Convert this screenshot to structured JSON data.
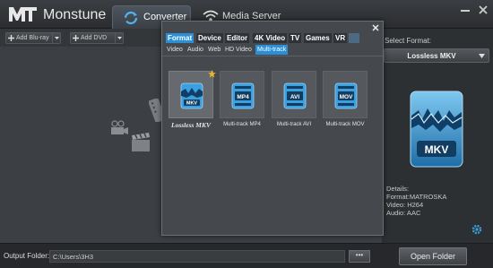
{
  "app": {
    "name": "Monstune",
    "tabs": [
      {
        "label": "Converter",
        "icon": "refresh-icon",
        "active": true
      },
      {
        "label": "Media Server",
        "icon": "wifi-icon",
        "active": false
      }
    ]
  },
  "toolbar": {
    "add_bluray": "Add Blu-ray",
    "add_dvd": "Add DVD"
  },
  "format_dialog": {
    "categories": [
      "Format",
      "Device",
      "Editor",
      "4K Video",
      "TV",
      "Games",
      "VR"
    ],
    "active_category": "Format",
    "subtabs": [
      "Video",
      "Audio",
      "Web",
      "HD Video",
      "Multi-track"
    ],
    "active_subtab": "Multi-track",
    "formats": [
      {
        "name": "Lossless MKV",
        "badge": "MKV",
        "selected": true,
        "favorite": true
      },
      {
        "name": "Multi-track MP4",
        "badge": "MP4",
        "selected": false
      },
      {
        "name": "Multi-track AVI",
        "badge": "AVI",
        "selected": false
      },
      {
        "name": "Multi-track MOV",
        "badge": "MOV",
        "selected": false
      }
    ]
  },
  "right_panel": {
    "select_format_label": "Select Format:",
    "selected_format": "Lossless MKV",
    "preview_badge": "MKV",
    "details": {
      "heading": "Details:",
      "format": "Format:MATROSKA",
      "video": "Video: H264",
      "audio": "Audio: AAC"
    }
  },
  "bottom": {
    "output_label": "Output Folder:",
    "output_path": "C:\\Users\\3H3",
    "browse_label": "•••",
    "open_folder": "Open Folder"
  },
  "colors": {
    "accent": "#2a8fd6",
    "icon_blue": "#3aa0e0"
  }
}
